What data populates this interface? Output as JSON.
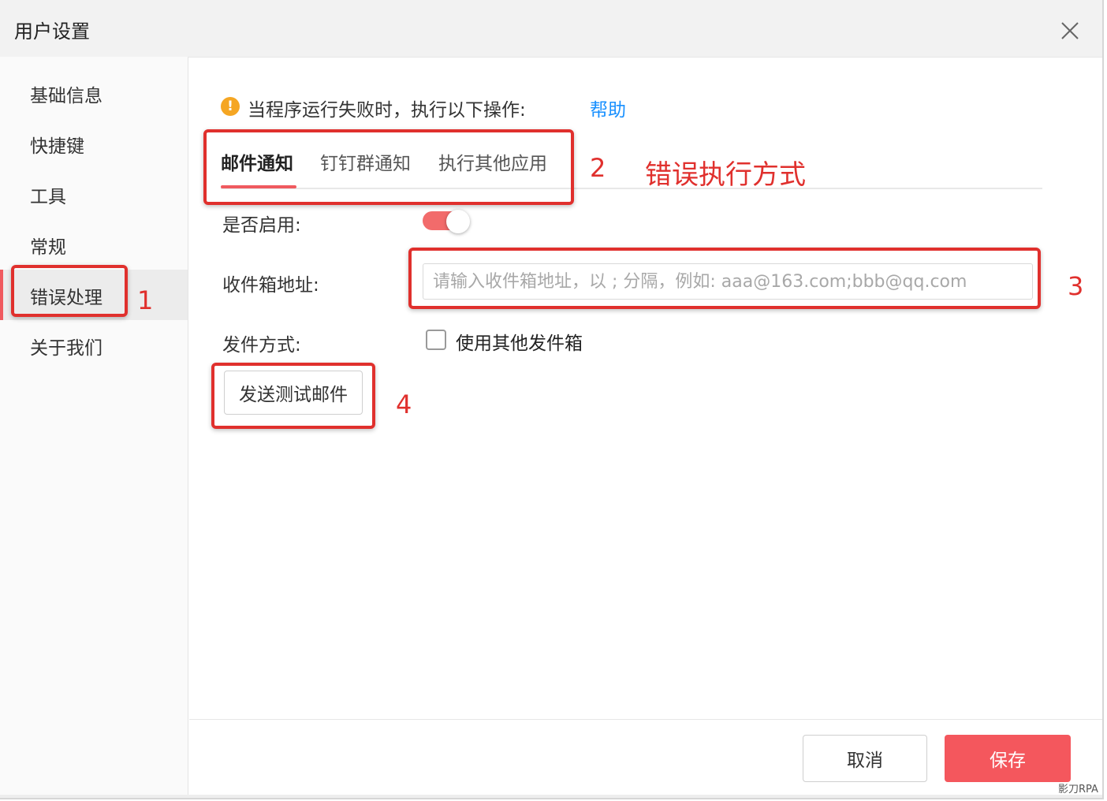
{
  "window": {
    "title": "用户设置",
    "close_icon": "close-icon"
  },
  "sidebar": {
    "items": [
      {
        "label": "基础信息",
        "active": false
      },
      {
        "label": "快捷键",
        "active": false
      },
      {
        "label": "工具",
        "active": false
      },
      {
        "label": "常规",
        "active": false
      },
      {
        "label": "错误处理",
        "active": true
      },
      {
        "label": "关于我们",
        "active": false
      }
    ]
  },
  "main": {
    "warning_icon": "exclamation-circle-icon",
    "warning_text": "当程序运行失败时，执行以下操作:",
    "help_link": "帮助",
    "tabs": [
      {
        "label": "邮件通知",
        "active": true
      },
      {
        "label": "钉钉群通知",
        "active": false
      },
      {
        "label": "执行其他应用",
        "active": false
      }
    ],
    "enable_label": "是否启用:",
    "enabled": true,
    "recipient_label": "收件箱地址:",
    "recipient_value": "",
    "recipient_placeholder": "请输入收件箱地址，以 ; 分隔，例如: aaa@163.com;bbb@qq.com",
    "send_method_label": "发件方式:",
    "use_other_mailbox_label": "使用其他发件箱",
    "use_other_mailbox_checked": false,
    "send_test_button": "发送测试邮件"
  },
  "footer": {
    "cancel_button": "取消",
    "save_button": "保存"
  },
  "annotations": {
    "n1": "1",
    "n2": "2",
    "n3": "3",
    "n4": "4",
    "tabs_caption": "错误执行方式",
    "color": "#e0302d"
  },
  "watermark": "影刀RPA",
  "colors": {
    "accent": "#f05a5f",
    "save": "#f4575d",
    "link": "#1890ff",
    "warning": "#f5a623"
  }
}
